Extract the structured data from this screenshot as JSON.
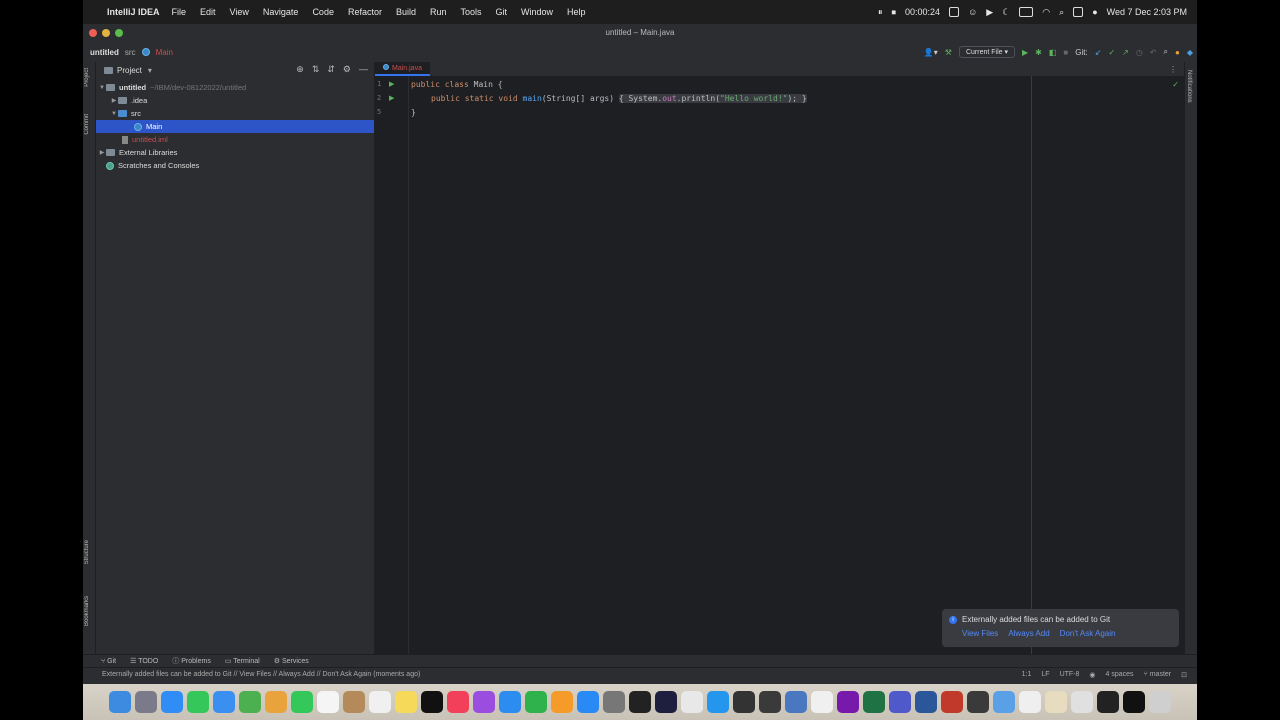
{
  "menubar": {
    "app_name": "IntelliJ IDEA",
    "menus": [
      "File",
      "Edit",
      "View",
      "Navigate",
      "Code",
      "Refactor",
      "Build",
      "Run",
      "Tools",
      "Git",
      "Window",
      "Help"
    ],
    "recording_time": "00:00:24",
    "datetime": "Wed 7 Dec  2:03 PM"
  },
  "window": {
    "title": "untitled – Main.java"
  },
  "toolbar": {
    "breadcrumb": [
      "untitled",
      "src",
      "Main"
    ],
    "run_config": "Current File",
    "git_label": "Git:"
  },
  "stripe": {
    "project": "Project",
    "commit": "Commit",
    "structure": "Structure",
    "bookmarks": "Bookmarks",
    "notifications": "Notifications"
  },
  "project": {
    "header": "Project",
    "tree": [
      {
        "label": "untitled",
        "hint": "~/IBM/dev-08122022/untitled"
      },
      {
        "label": ".idea"
      },
      {
        "label": "src"
      },
      {
        "label": "Main"
      },
      {
        "label": "untitled.iml"
      },
      {
        "label": "External Libraries"
      },
      {
        "label": "Scratches and Consoles"
      }
    ]
  },
  "editor": {
    "tab": "Main.java",
    "line_numbers": [
      "1",
      "2",
      "",
      "5"
    ],
    "code": {
      "l1_kw": "public class ",
      "l1_name": "Main",
      "l1_end": " {",
      "l2_kw": "public static void ",
      "l2_fn": "main",
      "l2_params": "(String[] args) ",
      "l2_open": "{ ",
      "l2_sys": "System.",
      "l2_out": "out",
      "l2_print": ".println(",
      "l2_str": "\"Hello world!\"",
      "l2_close": "); }",
      "l3": "}"
    }
  },
  "notification": {
    "text": "Externally added files can be added to Git",
    "actions": [
      "View Files",
      "Always Add",
      "Don't Ask Again"
    ]
  },
  "bottom_tools": [
    "Git",
    "TODO",
    "Problems",
    "Terminal",
    "Services"
  ],
  "status": {
    "message": "Externally added files can be added to Git // View Files // Always Add // Don't Ask Again (moments ago)",
    "position": "1:1",
    "line_sep": "LF",
    "encoding": "UTF-8",
    "indent": "4 spaces",
    "branch": "master"
  },
  "dock": [
    {
      "name": "Finder",
      "color": "#3d8be0"
    },
    {
      "name": "Launchpad",
      "color": "#7a7a8a"
    },
    {
      "name": "Safari",
      "color": "#2f8df5"
    },
    {
      "name": "Messages",
      "color": "#35c759"
    },
    {
      "name": "Mail",
      "color": "#3a8ff0"
    },
    {
      "name": "Maps",
      "color": "#4caf50"
    },
    {
      "name": "Photos",
      "color": "#e8a33d"
    },
    {
      "name": "FaceTime",
      "color": "#34c759"
    },
    {
      "name": "Calendar",
      "color": "#f5f5f5"
    },
    {
      "name": "Contacts",
      "color": "#b58a5a"
    },
    {
      "name": "Reminders",
      "color": "#f0f0f0"
    },
    {
      "name": "Notes",
      "color": "#f7d95a"
    },
    {
      "name": "TV",
      "color": "#111111"
    },
    {
      "name": "Music",
      "color": "#f2405b"
    },
    {
      "name": "Podcasts",
      "color": "#9b4de0"
    },
    {
      "name": "Keynote",
      "color": "#2d8cf0"
    },
    {
      "name": "Numbers",
      "color": "#2fb24c"
    },
    {
      "name": "Pages",
      "color": "#f59b2a"
    },
    {
      "name": "App Store",
      "color": "#2a8af5"
    },
    {
      "name": "System Preferences",
      "color": "#777777"
    },
    {
      "name": "Terminal",
      "color": "#222222"
    },
    {
      "name": "IntelliJ IDEA",
      "color": "#1e1e3f"
    },
    {
      "name": "Chrome",
      "color": "#e8e8e8"
    },
    {
      "name": "Docker",
      "color": "#2496ed"
    },
    {
      "name": "Postman",
      "color": "#333333"
    },
    {
      "name": "Sublime",
      "color": "#3a3a3a"
    },
    {
      "name": "Preview",
      "color": "#4a78c0"
    },
    {
      "name": "Clock",
      "color": "#f0f0f0"
    },
    {
      "name": "OneNote",
      "color": "#7719aa"
    },
    {
      "name": "Excel",
      "color": "#1f7244"
    },
    {
      "name": "Teams",
      "color": "#5059c9"
    },
    {
      "name": "Word",
      "color": "#2b579a"
    },
    {
      "name": "Recorder",
      "color": "#c0392b"
    },
    {
      "name": "QuickTime",
      "color": "#3a3a3a"
    },
    {
      "name": "Downloads",
      "color": "#5aa0e6"
    },
    {
      "name": "Folder1",
      "color": "#efefef"
    },
    {
      "name": "Folder2",
      "color": "#e8dcc0"
    },
    {
      "name": "Folder3",
      "color": "#e0e0e0"
    },
    {
      "name": "Window1",
      "color": "#222222"
    },
    {
      "name": "Window2",
      "color": "#111111"
    },
    {
      "name": "Trash",
      "color": "#cfcfcf"
    }
  ]
}
